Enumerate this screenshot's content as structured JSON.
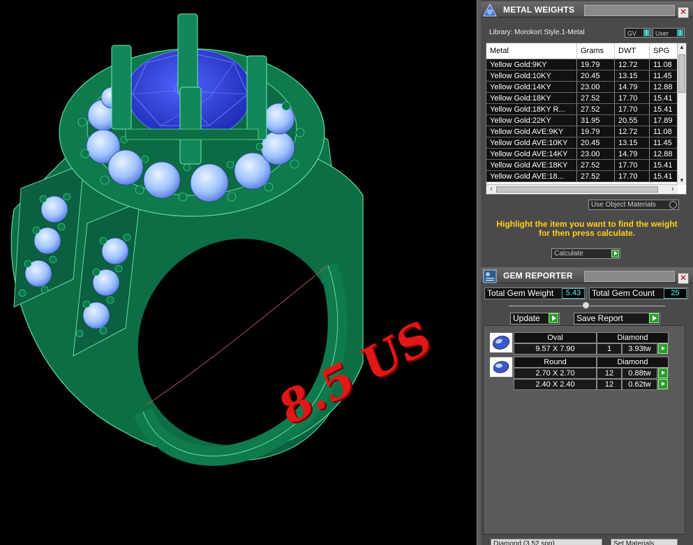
{
  "viewport": {
    "size_label": "8.5 US",
    "colors": {
      "ring": "#0f7a4e",
      "ring_edge": "#5fe0a0",
      "center_stone": "#2a3ad8",
      "side_stones": "#9fc4ff",
      "label": "#e01818"
    }
  },
  "metal_weights": {
    "title": "METAL WEIGHTS",
    "library": "Library: Morokort Style.1-Metal",
    "gv_label": "GV",
    "user_label": "User",
    "columns": [
      "Metal",
      "Grams",
      "DWT",
      "SPG"
    ],
    "rows": [
      [
        "Yellow Gold:9KY",
        "19.79",
        "12.72",
        "11.08"
      ],
      [
        "Yellow Gold:10KY",
        "20.45",
        "13.15",
        "11.45"
      ],
      [
        "Yellow Gold:14KY",
        "23.00",
        "14.79",
        "12.88"
      ],
      [
        "Yellow Gold:18KY",
        "27.52",
        "17.70",
        "15.41"
      ],
      [
        "Yellow Gold:18KY R...",
        "27.52",
        "17.70",
        "15.41"
      ],
      [
        "Yellow Gold:22KY",
        "31.95",
        "20.55",
        "17.89"
      ],
      [
        "Yellow Gold AVE:9KY",
        "19.79",
        "12.72",
        "11.08"
      ],
      [
        "Yellow Gold AVE:10KY",
        "20.45",
        "13.15",
        "11.45"
      ],
      [
        "Yellow Gold AVE:14KY",
        "23.00",
        "14.79",
        "12.88"
      ],
      [
        "Yellow Gold AVE:18KY",
        "27.52",
        "17.70",
        "15.41"
      ],
      [
        "Yellow Gold AVE:18...",
        "27.52",
        "17.70",
        "15.41"
      ]
    ],
    "use_object_materials": "Use Object Materials",
    "hint_line1": "Highlight the item you want to find the weight",
    "hint_line2": "for then press calculate.",
    "calculate_label": "Calculate"
  },
  "gem_reporter": {
    "title": "GEM REPORTER",
    "total_weight_label": "Total Gem Weight",
    "total_weight_value": "5.43",
    "total_count_label": "Total Gem Count",
    "total_count_value": "25",
    "update_label": "Update",
    "save_report_label": "Save Report",
    "groups": [
      {
        "shape": "Oval",
        "type": "Diamond",
        "rows": [
          {
            "size": "9.57 X 7.90",
            "count": "1",
            "weight": "3.93tw"
          }
        ]
      },
      {
        "shape": "Round",
        "type": "Diamond",
        "rows": [
          {
            "size": "2.70 X 2.70",
            "count": "12",
            "weight": "0.88tw"
          },
          {
            "size": "2.40 X 2.40",
            "count": "12",
            "weight": "0.62tw"
          }
        ]
      }
    ],
    "bottom_left": "Diamond  (3.52 spg)",
    "bottom_right": "Set Materials"
  }
}
